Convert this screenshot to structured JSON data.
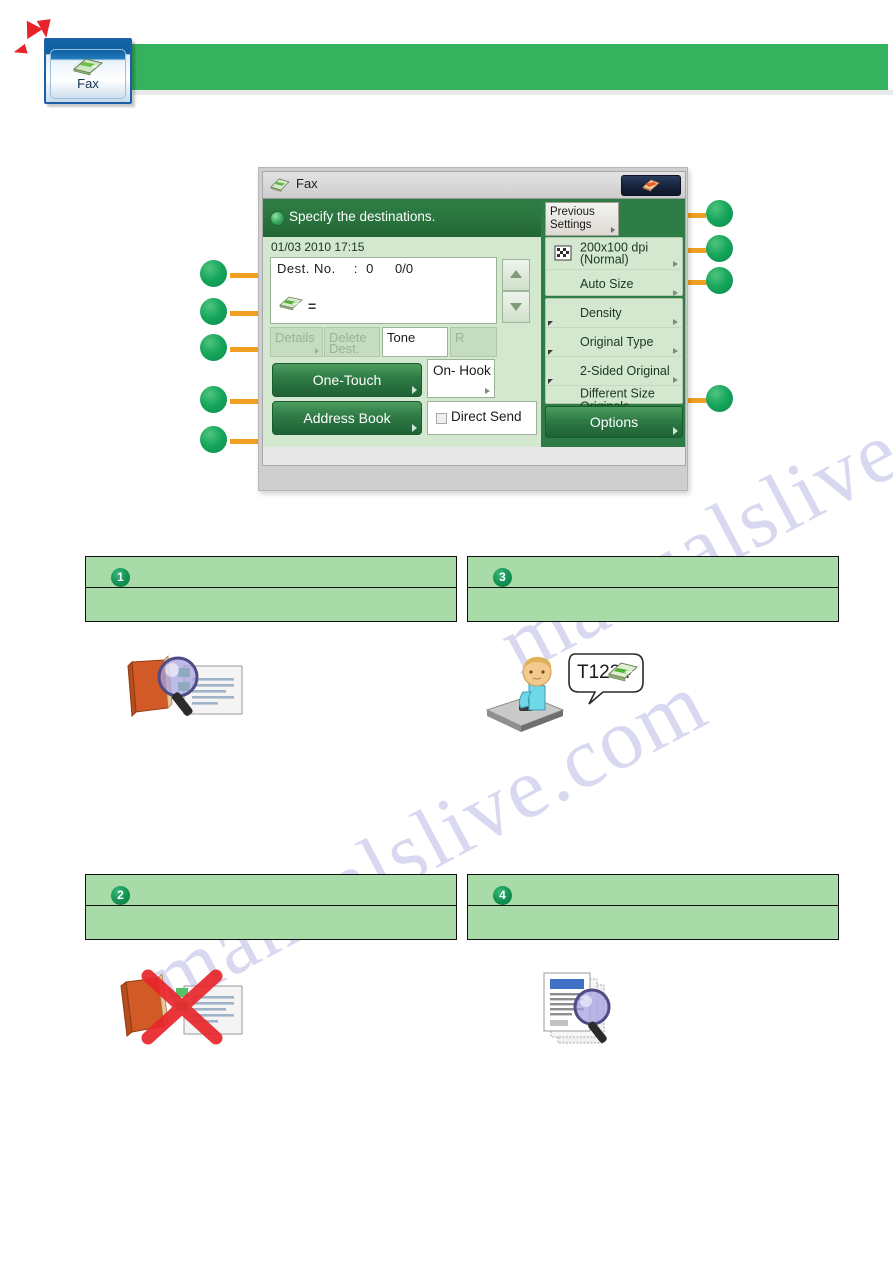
{
  "tab": {
    "label": "Fax",
    "icon": "fax-book-icon"
  },
  "panel": {
    "titlebar": {
      "title": "Fax",
      "icon": "fax-titlebar-icon",
      "right_button_icon": "paper-stack-icon"
    },
    "status": {
      "message": "Specify the destinations.",
      "icon": "status-bullet-icon"
    },
    "datetime": "01/03 2010  17:15",
    "destination": {
      "label": "Dest. No.",
      "separator": ":",
      "number": "0",
      "count": "0/0",
      "row_icon": "fax-destination-icon",
      "row_value": "=",
      "scroll_up_icon": "triangle-up-icon",
      "scroll_down_icon": "triangle-down-icon"
    },
    "small_buttons": [
      {
        "label": "Details",
        "enabled": false
      },
      {
        "label": "Delete Dest.",
        "enabled": false
      },
      {
        "label": "Tone",
        "enabled": true
      },
      {
        "label": "R",
        "enabled": false
      }
    ],
    "main_buttons": [
      {
        "label": "One-Touch"
      },
      {
        "label": "Address Book"
      }
    ],
    "on_hook": {
      "label": "On- Hook"
    },
    "direct_send": {
      "label": "Direct Send",
      "checked": false
    },
    "previous_settings": {
      "label": "Previous Settings"
    },
    "settings_group_1": [
      {
        "label": "200x100 dpi (Normal)",
        "icon": "resolution-icon"
      },
      {
        "label": "Auto Size",
        "icon": ""
      }
    ],
    "settings_group_2": [
      {
        "label": "Density"
      },
      {
        "label": "Original Type"
      },
      {
        "label": "2-Sided Original"
      },
      {
        "label": "Different Size Originals"
      }
    ],
    "options_button": {
      "label": "Options"
    }
  },
  "callouts": {
    "left": [
      "",
      "",
      "",
      "",
      ""
    ],
    "right": [
      "",
      "",
      "",
      ""
    ]
  },
  "blocks": [
    {
      "number": "1",
      "illustration": "address-book-search-icon"
    },
    {
      "number": "3",
      "illustration": "operator-keypad-tone-icon",
      "bubble_text": "T1234"
    },
    {
      "number": "2",
      "illustration": "address-book-crossed-out-icon"
    },
    {
      "number": "4",
      "illustration": "documents-search-icon"
    }
  ],
  "watermark": {
    "line1": "manualslive.com",
    "line2": "manualslive.com"
  },
  "colors": {
    "banner_green": "#35b25e",
    "block_green": "#a8dba8",
    "bullet_green": "#16a55c",
    "lead_orange": "#f0a020",
    "panel_status_green": "#2b7740"
  }
}
